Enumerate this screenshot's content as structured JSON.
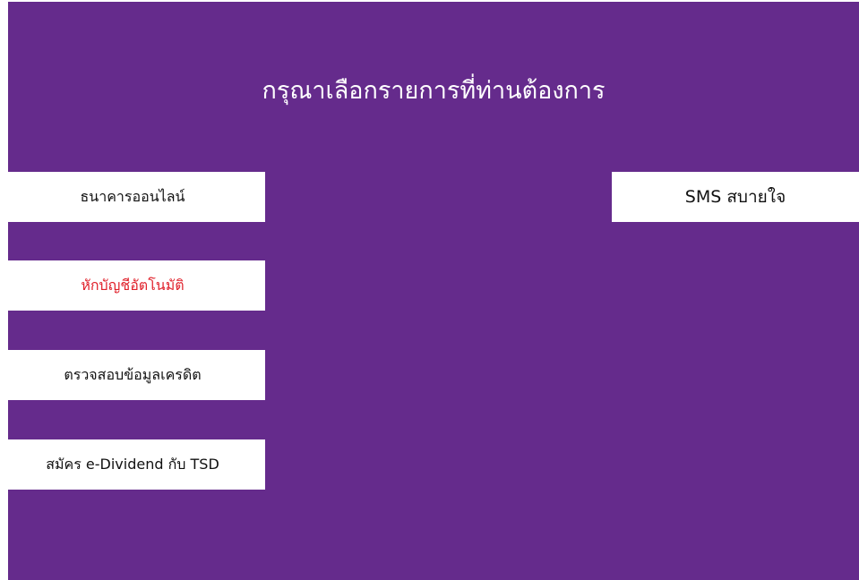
{
  "page": {
    "title": "กรุณาเลือกรายการที่ท่านต้องการ"
  },
  "menu": {
    "left_items": [
      {
        "label": "ธนาคารออนไลน์"
      },
      {
        "label": "หักบัญชีอัตโนมัติ"
      },
      {
        "label": "ตรวจสอบข้อมูลเครดิต"
      },
      {
        "label": "สมัคร e-Dividend กับ TSD"
      }
    ],
    "right_items": [
      {
        "label": "SMS สบายใจ"
      }
    ]
  },
  "colors": {
    "background": "#652b8c",
    "button": "#ffffff",
    "text": "#111111",
    "highlight_text": "#e0202a"
  }
}
